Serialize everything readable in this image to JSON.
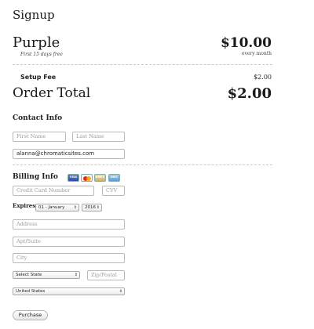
{
  "header": {
    "title": "Signup"
  },
  "plan": {
    "name": "Purple",
    "subtitle": "First 15 days free",
    "price": "$10.00",
    "period": "every month"
  },
  "fees": {
    "setup_label": "Setup Fee",
    "setup_value": "$2.00"
  },
  "total": {
    "label": "Order Total",
    "value": "$2.00"
  },
  "contact": {
    "title": "Contact Info",
    "first_name_placeholder": "First Name",
    "last_name_placeholder": "Last Name",
    "email_value": "alanna@chromaticsites.com"
  },
  "billing": {
    "title": "Billing Info",
    "cards": [
      "VISA",
      "MC",
      "AMEX",
      "DISC"
    ],
    "card_number_placeholder": "Credit Card Number",
    "cvv_placeholder": "CVV",
    "expires_label": "Expires",
    "expires_month": "01 - January",
    "expires_year": "2016",
    "address_placeholder": "Address",
    "apt_placeholder": "Apt/Suite",
    "city_placeholder": "City",
    "state_select": "Select State",
    "zip_placeholder": "Zip/Postal",
    "country_select": "United States"
  },
  "actions": {
    "purchase_label": "Purchase"
  }
}
